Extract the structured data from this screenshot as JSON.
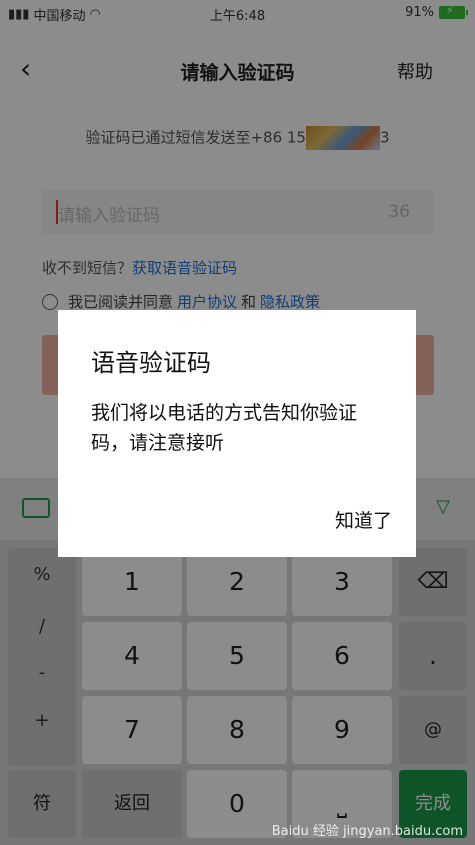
{
  "status": {
    "carrier": "中国移动",
    "time": "上午6:48",
    "battery": "91%"
  },
  "header": {
    "title": "请输入验证码",
    "help": "帮助"
  },
  "sent_prefix": "验证码已通过短信发送至+86 15",
  "sent_suffix": "3",
  "code_input": {
    "placeholder": "请输入验证码",
    "countdown": "36"
  },
  "no_sms": {
    "text": "收不到短信？",
    "link": "获取语音验证码"
  },
  "agree": {
    "text": "我已阅读并同意",
    "terms": "用户协议",
    "and": "和",
    "privacy": "隐私政策"
  },
  "keyboard": {
    "symbols": [
      "%",
      "/",
      "-",
      "+"
    ],
    "digits": [
      "1",
      "2",
      "3",
      "4",
      "5",
      "6",
      "7",
      "8",
      "9",
      "0"
    ],
    "dot": ".",
    "at": "@",
    "fu": "符",
    "back": "返回",
    "done": "完成"
  },
  "dialog": {
    "title": "语音验证码",
    "body": "我们将以电话的方式告知你验证码，请注意接听",
    "ok": "知道了"
  },
  "watermark": "Baidu 经验 jingyan.baidu.com"
}
